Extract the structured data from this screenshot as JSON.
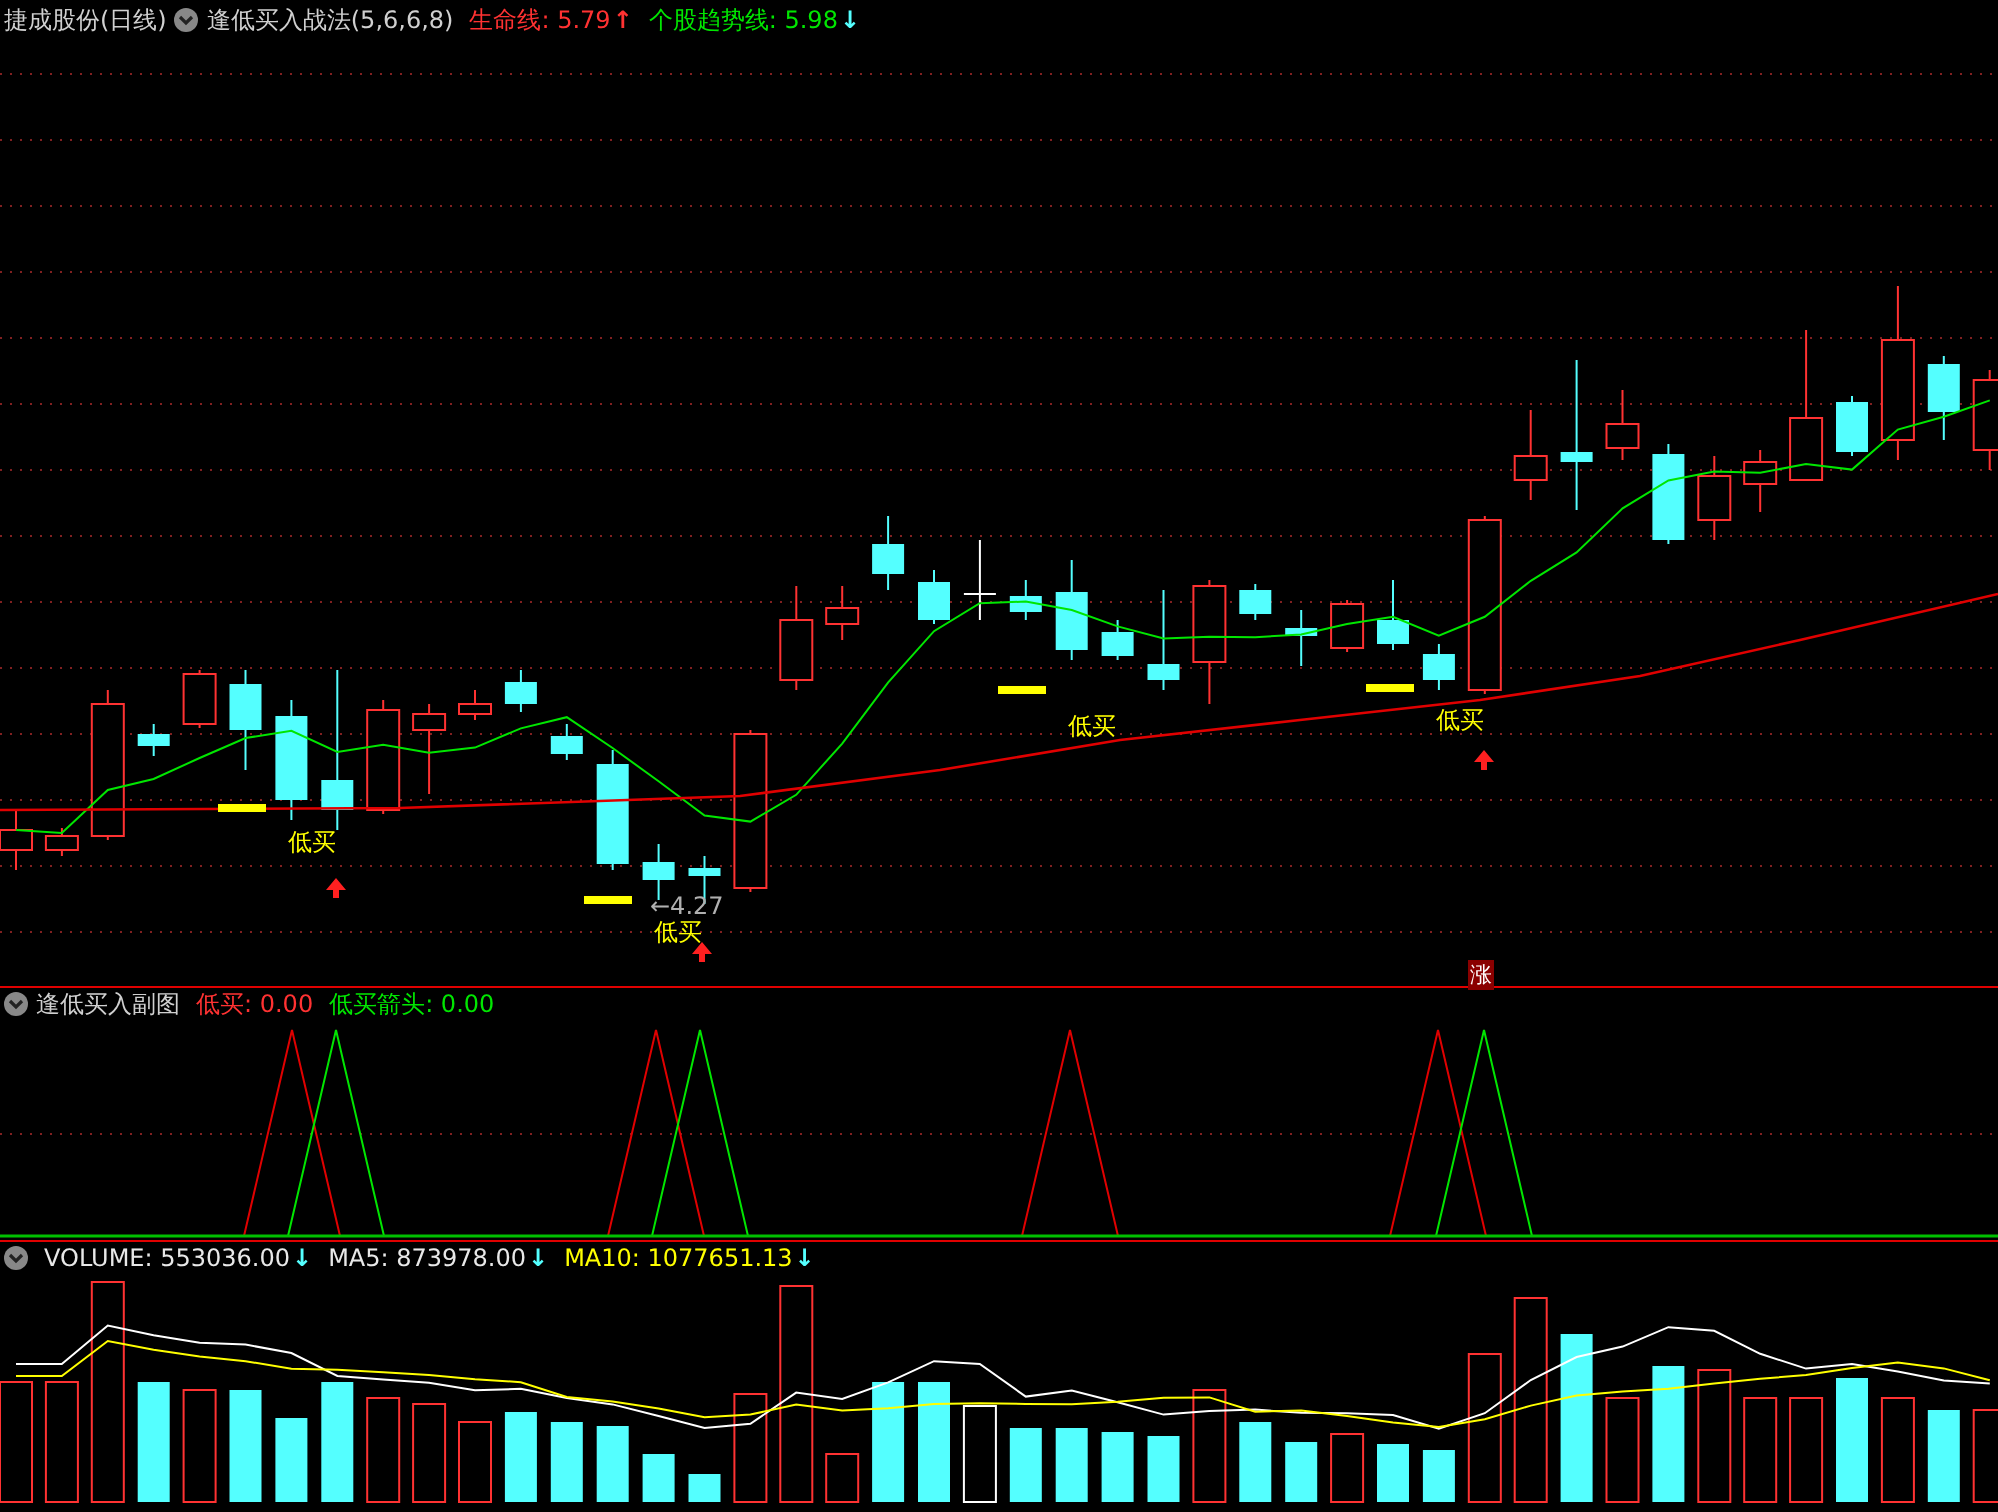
{
  "header": {
    "title": "捷成股份(日线)",
    "indicator": "逢低买入战法(5,6,6,8)",
    "values": [
      {
        "label": "生命线: 5.79",
        "arrow": "↑",
        "color": "#ff3232"
      },
      {
        "label": "个股趋势线: 5.98",
        "arrow": "↓",
        "color": "#00e600"
      }
    ]
  },
  "main_chart": {
    "signals": [
      "低买",
      "低买",
      "低买",
      "低买"
    ],
    "price_marker": {
      "arrow": "←",
      "label": "4.27"
    },
    "badge": "涨"
  },
  "sub_panel": {
    "title": "逢低买入副图",
    "values": [
      {
        "label": "低买: 0.00",
        "color": "#ff3232"
      },
      {
        "label": "低买箭头: 0.00",
        "color": "#00e600"
      }
    ]
  },
  "volume_panel": {
    "values": [
      {
        "label": "VOLUME: 553036.00",
        "arrow": "↓",
        "color": "#e8e8e8"
      },
      {
        "label": "MA5: 873978.00",
        "arrow": "↓",
        "color": "#e8e8e8"
      },
      {
        "label": "MA10: 1077651.13",
        "arrow": "↓",
        "color": "#ffff00"
      }
    ]
  }
}
